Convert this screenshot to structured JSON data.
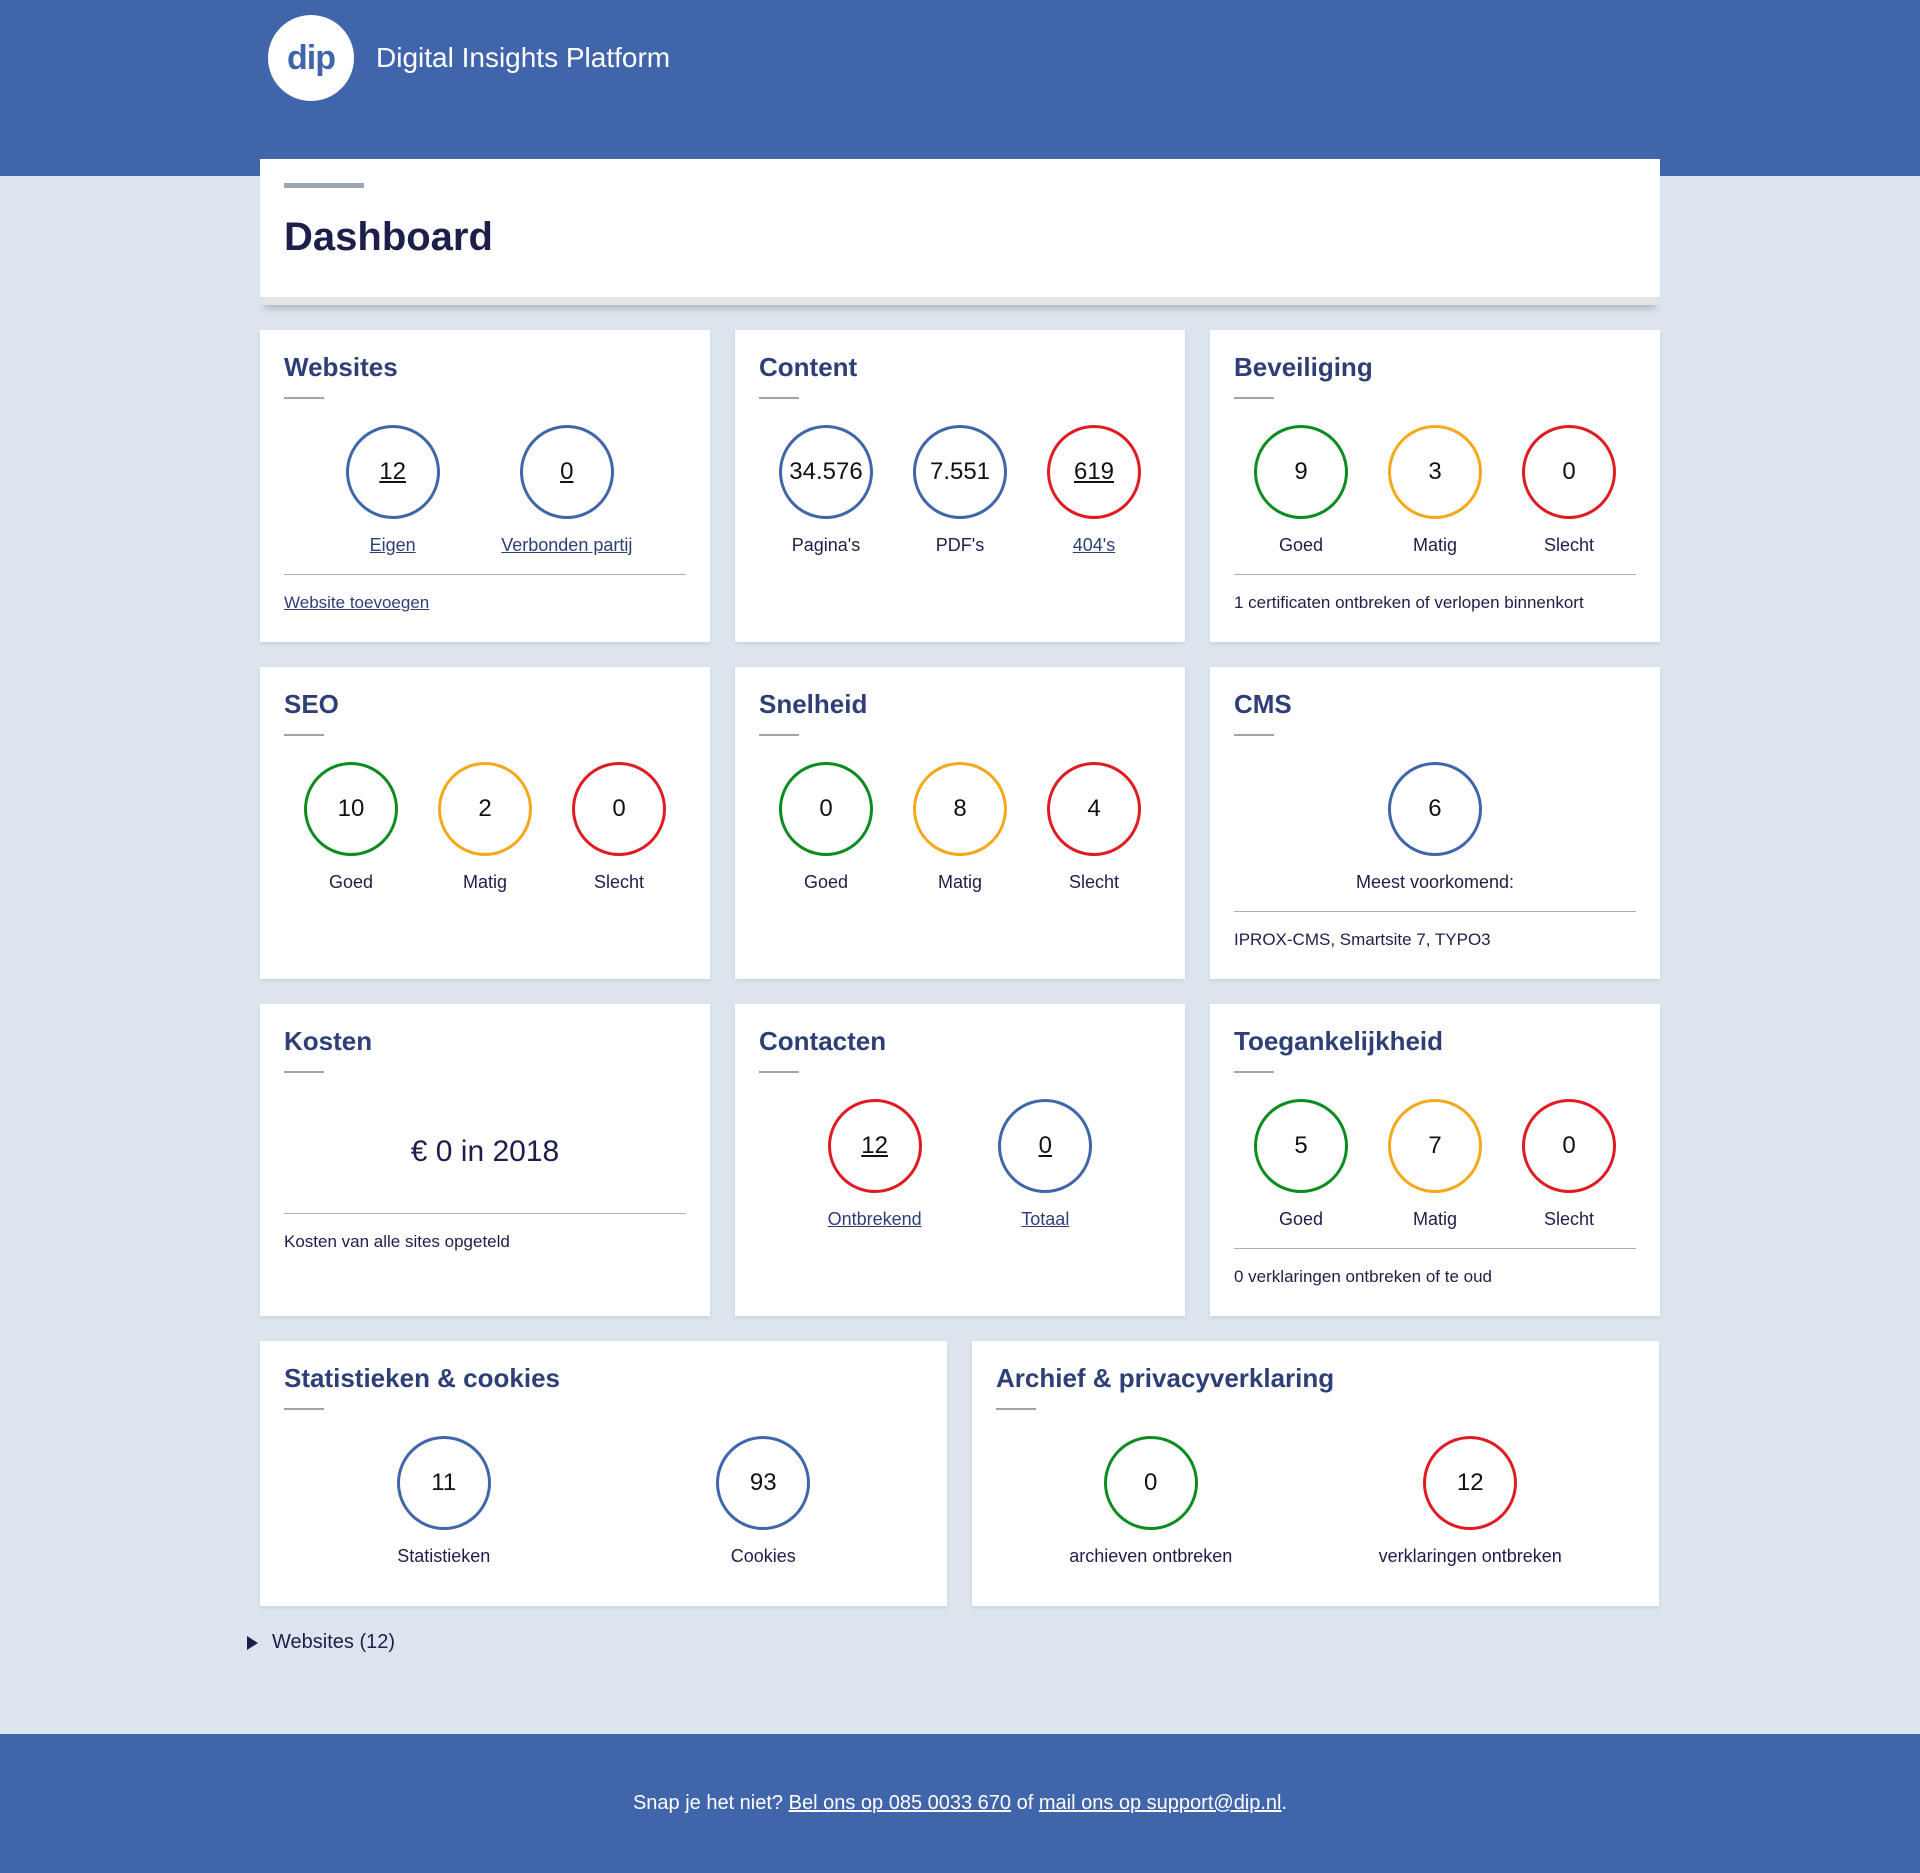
{
  "header": {
    "logo_text": "dip",
    "brand": "Digital Insights Platform"
  },
  "page_title": "Dashboard",
  "cards": {
    "websites": {
      "title": "Websites",
      "metrics": [
        {
          "value": "12",
          "label": "Eigen"
        },
        {
          "value": "0",
          "label": "Verbonden partij"
        }
      ],
      "footer": "Website toevoegen"
    },
    "content": {
      "title": "Content",
      "metrics": [
        {
          "value": "34.576",
          "label": "Pagina's"
        },
        {
          "value": "7.551",
          "label": "PDF's"
        },
        {
          "value": "619",
          "label": "404's"
        }
      ]
    },
    "beveiliging": {
      "title": "Beveiliging",
      "metrics": [
        {
          "value": "9",
          "label": "Goed"
        },
        {
          "value": "3",
          "label": "Matig"
        },
        {
          "value": "0",
          "label": "Slecht"
        }
      ],
      "footer": "1 certificaten ontbreken of verlopen binnenkort"
    },
    "seo": {
      "title": "SEO",
      "metrics": [
        {
          "value": "10",
          "label": "Goed"
        },
        {
          "value": "2",
          "label": "Matig"
        },
        {
          "value": "0",
          "label": "Slecht"
        }
      ]
    },
    "snelheid": {
      "title": "Snelheid",
      "metrics": [
        {
          "value": "0",
          "label": "Goed"
        },
        {
          "value": "8",
          "label": "Matig"
        },
        {
          "value": "4",
          "label": "Slecht"
        }
      ]
    },
    "cms": {
      "title": "CMS",
      "metrics": [
        {
          "value": "6",
          "label": "Meest voorkomend:"
        }
      ],
      "footer": "IPROX-CMS, Smartsite 7, TYPO3"
    },
    "kosten": {
      "title": "Kosten",
      "amount": "€ 0 in 2018",
      "footer": "Kosten van alle sites opgeteld"
    },
    "contacten": {
      "title": "Contacten",
      "metrics": [
        {
          "value": "12",
          "label": "Ontbrekend"
        },
        {
          "value": "0",
          "label": "Totaal"
        }
      ]
    },
    "toegankelijkheid": {
      "title": "Toegankelijkheid",
      "metrics": [
        {
          "value": "5",
          "label": "Goed"
        },
        {
          "value": "7",
          "label": "Matig"
        },
        {
          "value": "0",
          "label": "Slecht"
        }
      ],
      "footer": "0 verklaringen ontbreken of te oud"
    },
    "statistieken": {
      "title": "Statistieken & cookies",
      "metrics": [
        {
          "value": "11",
          "label": "Statistieken"
        },
        {
          "value": "93",
          "label": "Cookies"
        }
      ]
    },
    "archief": {
      "title": "Archief & privacyverklaring",
      "metrics": [
        {
          "value": "0",
          "label": "archieven ontbreken"
        },
        {
          "value": "12",
          "label": "verklaringen ontbreken"
        }
      ]
    }
  },
  "summary": "Websites (12)",
  "footer": {
    "text_before": "Snap je het niet? ",
    "phone_link": "Bel ons op 085 0033 670",
    "text_middle": " of ",
    "mail_link": "mail ons op support@dip.nl",
    "text_after": "."
  },
  "colors": {
    "primary": "#4165aa",
    "good": "#0c8c1e",
    "medium": "#f5a81c",
    "bad": "#e01b22",
    "background": "#dce5ee"
  }
}
